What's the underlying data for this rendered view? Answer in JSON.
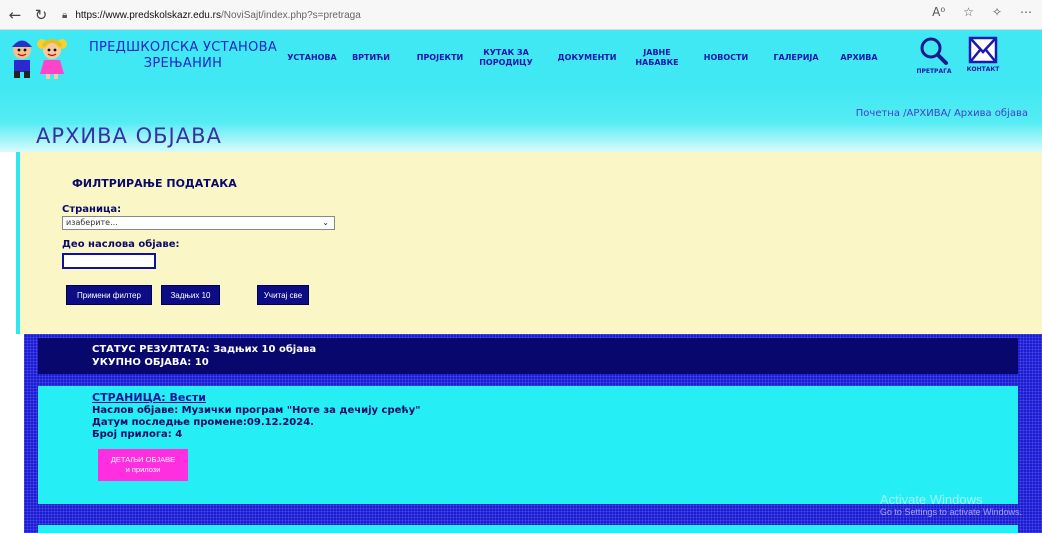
{
  "browser": {
    "url_host": "https://www.predskolskazr.edu.rs",
    "url_path": "/NoviSajt/index.php?s=pretraga"
  },
  "header": {
    "title_line1": "ПРЕДШКОЛСКА УСТАНОВА",
    "title_line2": "ЗРЕЊАНИН",
    "menu": [
      "УСТАНОВА",
      "ВРТИЋИ",
      "ПРОЈЕКТИ",
      "КУТАК ЗА ПОРОДИЦУ",
      "ДОКУМЕНТИ",
      "ЈАВНЕ НАБАВКЕ",
      "НОВОСТИ",
      "ГАЛЕРИЈА",
      "АРХИВА"
    ],
    "search_label": "ПРЕТРАГА",
    "contact_label": "КОНТАКТ"
  },
  "banner": {
    "breadcrumb": "Почетна /АРХИВА/ Архива објава",
    "page_title": "АРХИВА ОБЈАВА"
  },
  "filter": {
    "heading": "ФИЛТРИРАЊЕ ПОДАТАКА",
    "page_label": "Страница:",
    "page_select_value": "изаберите...",
    "title_label": "Део наслова објаве:",
    "title_input_value": "",
    "buttons": {
      "apply": "Примени филтер",
      "last10": "Задњих 10",
      "load_all": "Учитај све"
    }
  },
  "results": {
    "status_line": "СТАТУС РЕЗУЛТАТА: Задњих 10 објава",
    "total_line": "УКУПНО ОБЈАВА: 10",
    "posts": [
      {
        "page": "СТРАНИЦА: Вести",
        "title": "Наслов објаве: Музички програм \"Ноте за дечију срећу\"",
        "date": "Датум последње промене:09.12.2024.",
        "attachments": "Број прилога: 4",
        "details_line1": "ДЕТАЉИ ОБЈАВЕ",
        "details_line2": "и прилози"
      }
    ]
  },
  "watermark": {
    "line1": "Activate Windows",
    "line2": "Go to Settings to activate Windows."
  },
  "colors": {
    "header_bg": "#3fe8f2",
    "filter_bg": "#fbf6c6",
    "button_bg": "#0c0c84",
    "results_bg": "#1c1cd6",
    "status_bg": "#07076e",
    "post_bg": "#25eef5",
    "details_btn": "#ff2ee0"
  }
}
